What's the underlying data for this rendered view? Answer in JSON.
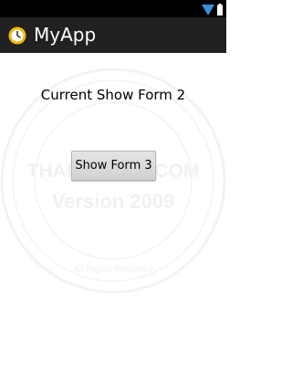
{
  "status_bar": {
    "icons": [
      "wifi-icon",
      "battery-icon"
    ],
    "background": "#000000"
  },
  "action_bar": {
    "icon": "app-icon",
    "title": "MyApp",
    "background": "#212121"
  },
  "watermark": {
    "line1": "THAICREATE.COM",
    "line2": "Version 2009",
    "ring_top": "ThaiCreate.Com Team",
    "ring_bottom": "All Rights Reserved",
    "color": "#f2f2f2"
  },
  "main": {
    "label": "Current Show Form 2",
    "button_label": "Show Form 3"
  }
}
